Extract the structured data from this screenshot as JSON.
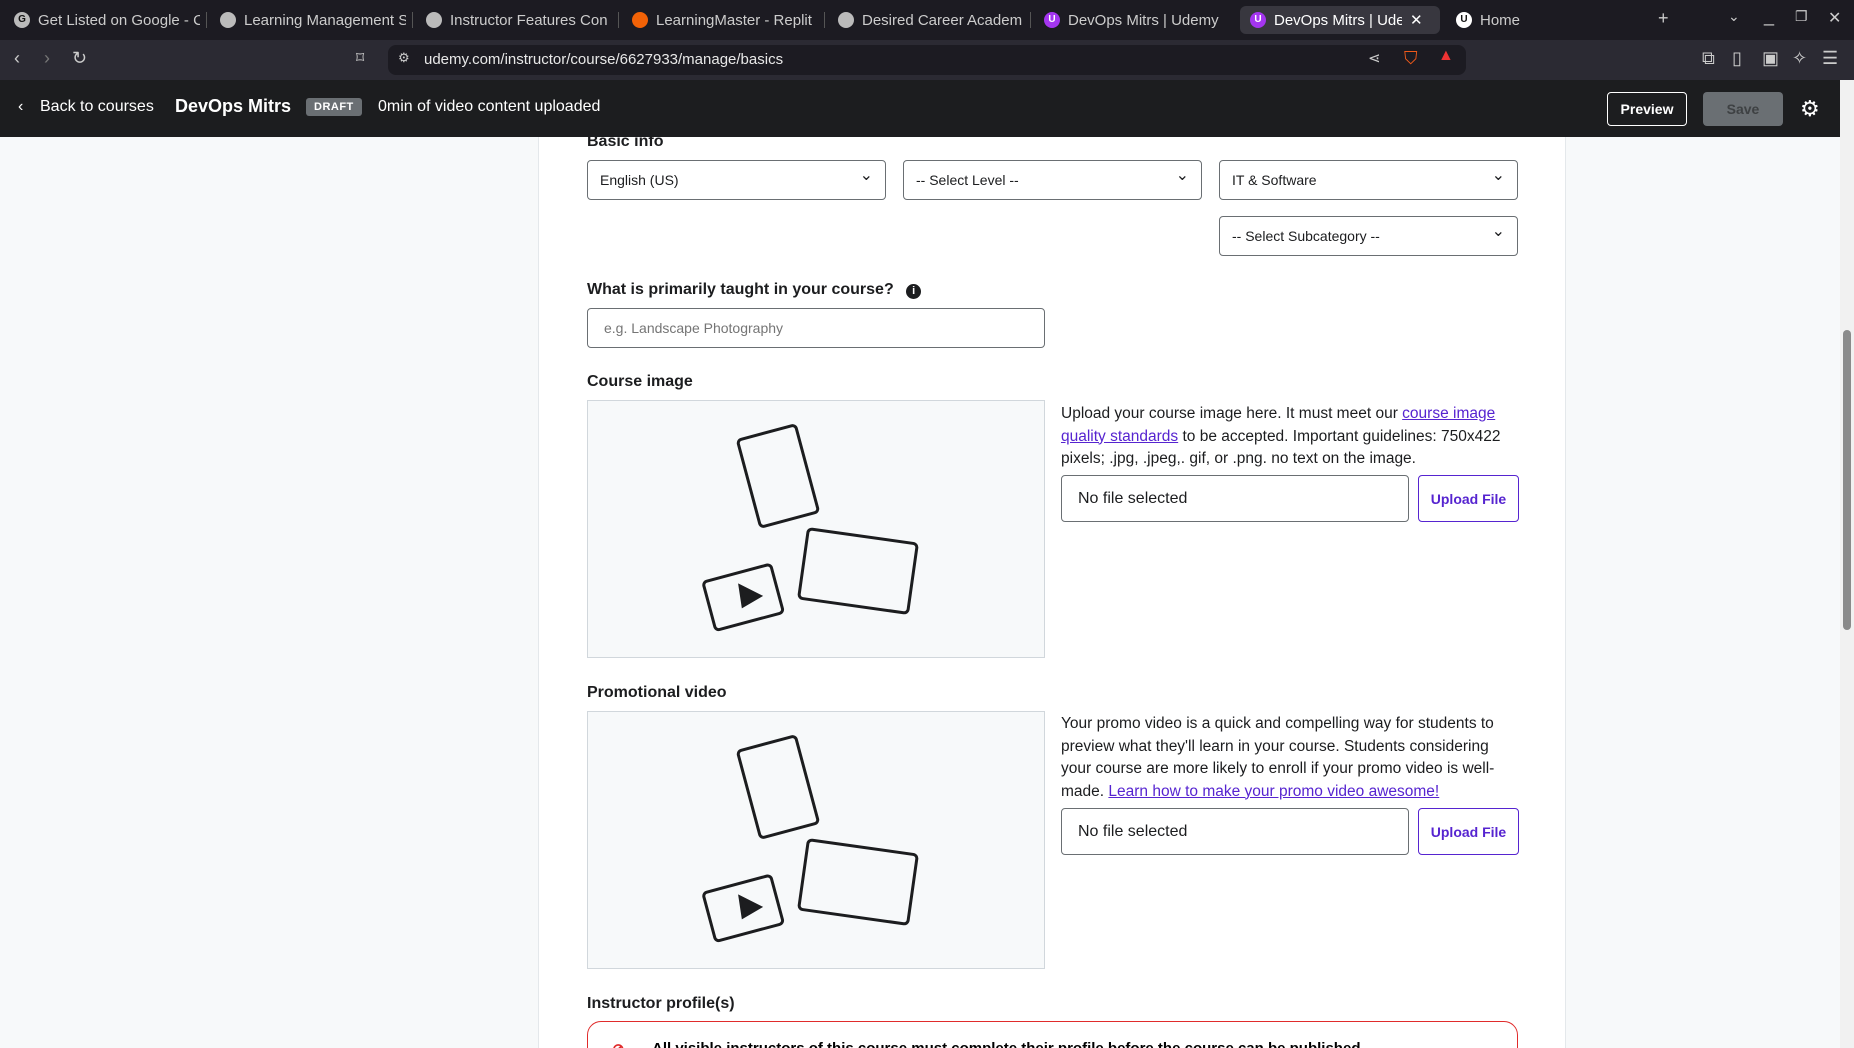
{
  "browser": {
    "tabs": [
      {
        "title": "Get Listed on Google - C",
        "icon": "google-icon"
      },
      {
        "title": "Learning Management S",
        "icon": "openai-icon"
      },
      {
        "title": "Instructor Features Con",
        "icon": "openai-icon"
      },
      {
        "title": "LearningMaster - Replit",
        "icon": "replit-icon"
      },
      {
        "title": "Desired Career Academ",
        "icon": "globe-icon"
      },
      {
        "title": "DevOps Mitrs | Udemy",
        "icon": "udemy-icon"
      },
      {
        "title": "DevOps Mitrs | Udemy",
        "icon": "udemy-icon",
        "active": true
      },
      {
        "title": "Home",
        "icon": "udemy-icon"
      }
    ],
    "url": "udemy.com/instructor/course/6627933/manage/basics"
  },
  "header": {
    "back": "Back to courses",
    "course_title": "DevOps Mitrs",
    "status": "DRAFT",
    "video_status": "0min of video content uploaded",
    "preview": "Preview",
    "save": "Save"
  },
  "basic_info": {
    "label": "Basic info",
    "language": "English (US)",
    "level": "-- Select Level --",
    "category": "IT & Software",
    "subcategory": "-- Select Subcategory --"
  },
  "taught": {
    "label": "What is primarily taught in your course?",
    "placeholder": "e.g. Landscape Photography"
  },
  "course_image": {
    "label": "Course image",
    "text1": "Upload your course image here. It must meet our ",
    "link": "course image quality standards",
    "text2": " to be accepted. Important guidelines: 750x422 pixels; .jpg, .jpeg,. gif, or .png. no text on the image.",
    "file": "No file selected",
    "button": "Upload File"
  },
  "promo_video": {
    "label": "Promotional video",
    "text1": "Your promo video is a quick and compelling way for students to preview what they'll learn in your course. Students considering your course are more likely to enroll if your promo video is well-made. ",
    "link": "Learn how to make your promo video awesome!",
    "file": "No file selected",
    "button": "Upload File"
  },
  "instructors": {
    "label": "Instructor profile(s)",
    "alert": "All visible instructors of this course must complete their profile before the course can be published."
  }
}
